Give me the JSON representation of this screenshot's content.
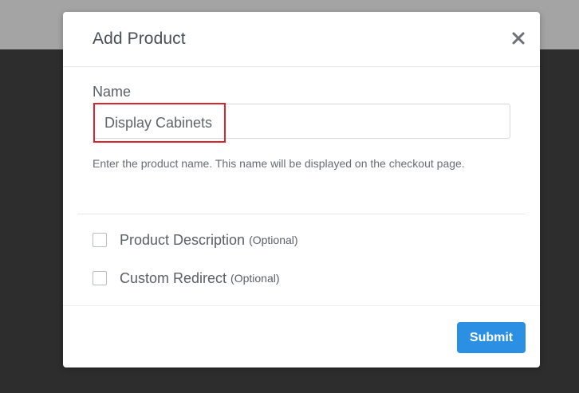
{
  "modal": {
    "title": "Add Product",
    "close_icon": "close-icon"
  },
  "name_field": {
    "label": "Name",
    "value": "Display Cabinets",
    "help_text": "Enter the product name. This name will be displayed on the checkout page."
  },
  "options": [
    {
      "label": "Product Description",
      "optional_tag": "(Optional)",
      "checked": false
    },
    {
      "label": "Custom Redirect",
      "optional_tag": "(Optional)",
      "checked": false
    }
  ],
  "footer": {
    "submit_label": "Submit"
  },
  "colors": {
    "accent": "#2b90e3",
    "highlight": "#e0242f",
    "backdrop_top": "#a4a4a4",
    "backdrop": "#2d2d2d"
  }
}
